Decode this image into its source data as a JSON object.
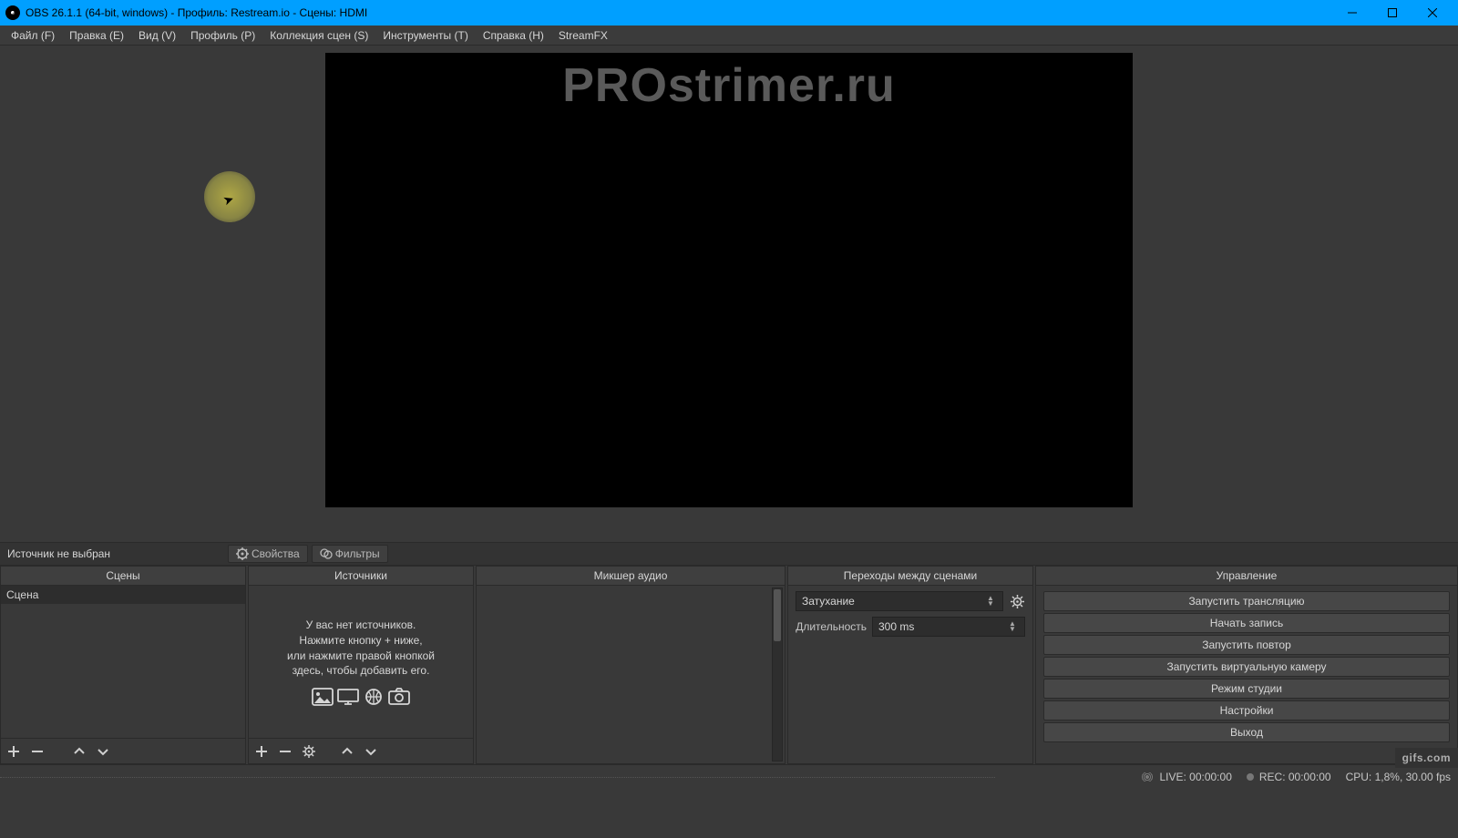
{
  "titlebar": {
    "title": "OBS 26.1.1 (64-bit, windows) - Профиль: Restream.io - Сцены: HDMI"
  },
  "menu": [
    "Файл (F)",
    "Правка (E)",
    "Вид (V)",
    "Профиль (P)",
    "Коллекция сцен (S)",
    "Инструменты (T)",
    "Справка (H)",
    "StreamFX"
  ],
  "preview": {
    "watermark": "PROstrimer.ru"
  },
  "mid_toolbar": {
    "status": "Источник не выбран",
    "properties": "Свойства",
    "filters": "Фильтры"
  },
  "docks": {
    "scenes": {
      "title": "Сцены",
      "items": [
        "Сцена"
      ]
    },
    "sources": {
      "title": "Источники",
      "empty_l1": "У вас нет источников.",
      "empty_l2": "Нажмите кнопку + ниже,",
      "empty_l3": "или нажмите правой кнопкой",
      "empty_l4": "здесь, чтобы добавить его."
    },
    "mixer": {
      "title": "Микшер аудио"
    },
    "transitions": {
      "title": "Переходы между сценами",
      "selected": "Затухание",
      "duration_label": "Длительность",
      "duration_value": "300 ms"
    },
    "controls": {
      "title": "Управление",
      "buttons": [
        "Запустить трансляцию",
        "Начать запись",
        "Запустить повтор",
        "Запустить виртуальную камеру",
        "Режим студии",
        "Настройки",
        "Выход"
      ]
    }
  },
  "statusbar": {
    "live": "LIVE: 00:00:00",
    "rec": "REC: 00:00:00",
    "cpu": "CPU: 1,8%, 30.00 fps"
  },
  "badge": "gifs.com"
}
